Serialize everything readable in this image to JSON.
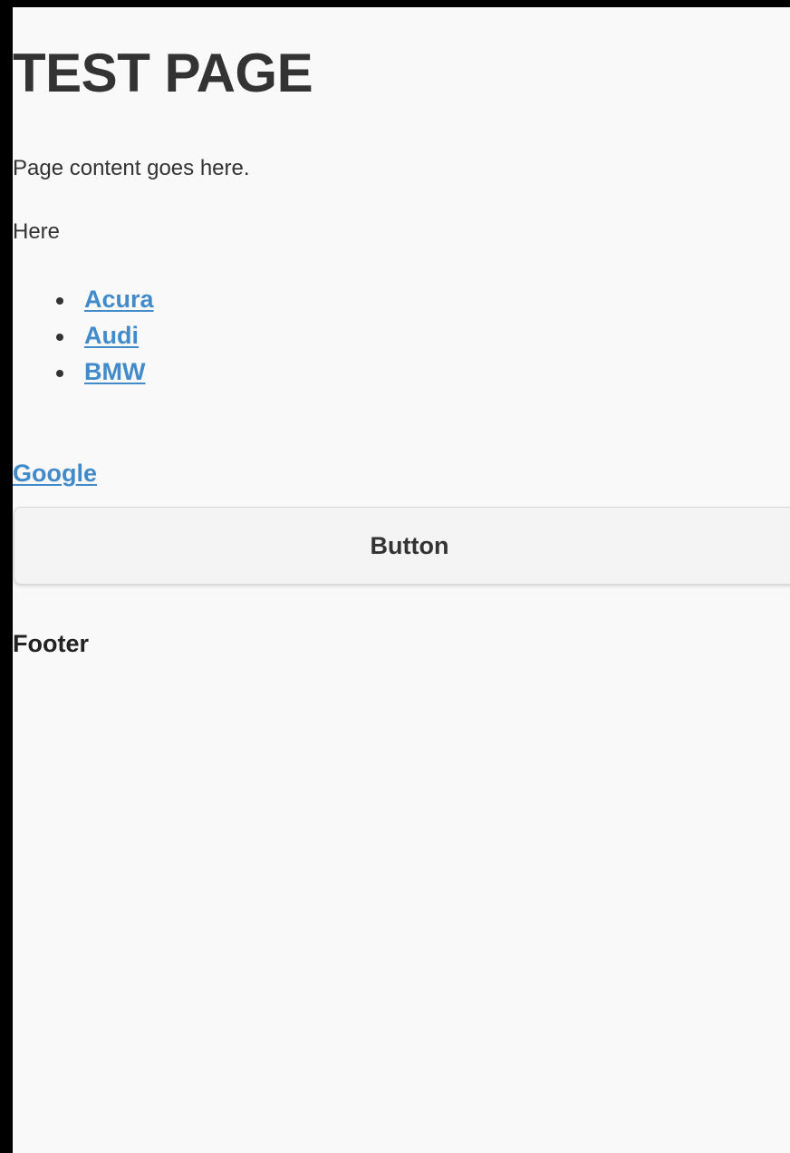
{
  "page": {
    "title": "TEST PAGE",
    "content_text": "Page content goes here.",
    "here_text": "Here"
  },
  "cars": [
    {
      "label": "Acura"
    },
    {
      "label": "Audi"
    },
    {
      "label": "BMW"
    }
  ],
  "links": {
    "google_label": "Google"
  },
  "button": {
    "label": "Button"
  },
  "footer": {
    "text": "Footer"
  },
  "colors": {
    "background": "#f9f9f9",
    "text": "#333333",
    "link": "#428bca",
    "button_bg": "#f4f4f4"
  }
}
